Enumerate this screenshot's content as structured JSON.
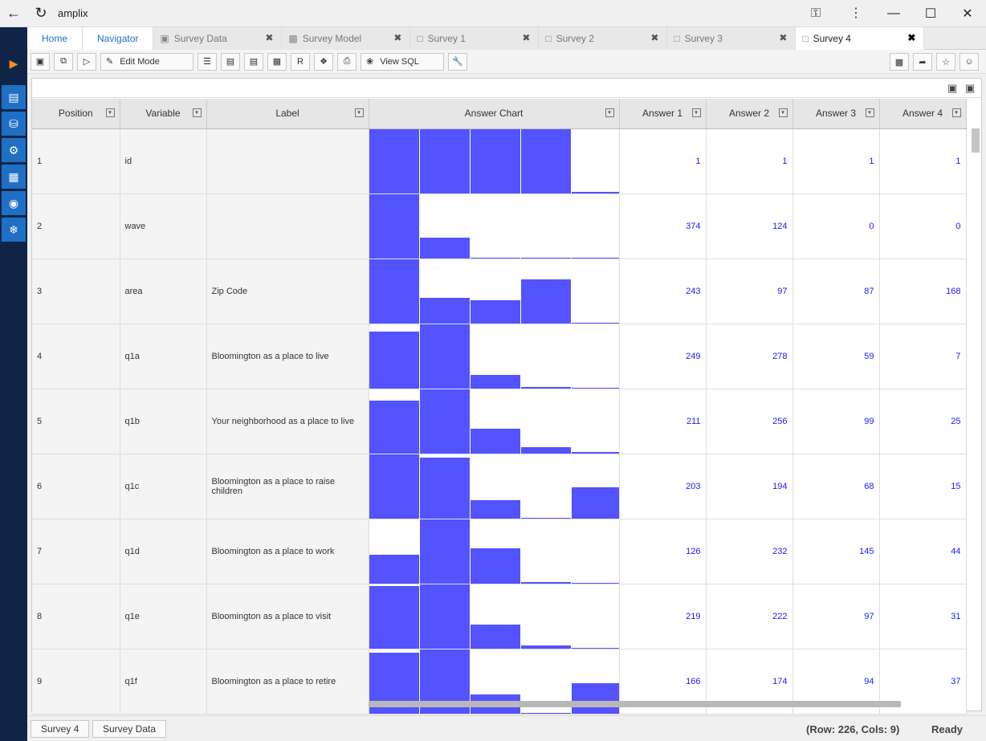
{
  "window": {
    "title": "amplix",
    "minimize": "—",
    "maximize": "☐",
    "close": "✕"
  },
  "nav": {
    "home": "Home",
    "navigator": "Navigator"
  },
  "tabs": [
    {
      "label": "Survey Data",
      "icon": "cube-icon"
    },
    {
      "label": "Survey Model",
      "icon": "model-icon"
    },
    {
      "label": "Survey 1",
      "icon": "file-icon"
    },
    {
      "label": "Survey 2",
      "icon": "file-icon"
    },
    {
      "label": "Survey 3",
      "icon": "file-icon"
    },
    {
      "label": "Survey 4",
      "icon": "file-icon",
      "active": true
    }
  ],
  "toolbar": {
    "edit_mode": "Edit Mode",
    "view_sql": "View SQL"
  },
  "columns": [
    "Position",
    "Variable",
    "Label",
    "Answer Chart",
    "Answer 1",
    "Answer 2",
    "Answer 3",
    "Answer 4"
  ],
  "rows": [
    {
      "position": "1",
      "variable": "id",
      "label": "",
      "answers": [
        "1",
        "1",
        "1",
        "1"
      ]
    },
    {
      "position": "2",
      "variable": "wave",
      "label": "",
      "answers": [
        "374",
        "124",
        "0",
        "0"
      ]
    },
    {
      "position": "3",
      "variable": "area",
      "label": "Zip Code",
      "answers": [
        "243",
        "97",
        "87",
        "168"
      ]
    },
    {
      "position": "4",
      "variable": "q1a",
      "label": "Bloomington as a place to live",
      "answers": [
        "249",
        "278",
        "59",
        "7"
      ]
    },
    {
      "position": "5",
      "variable": "q1b",
      "label": "Your neighborhood as a place to live",
      "answers": [
        "211",
        "256",
        "99",
        "25"
      ]
    },
    {
      "position": "6",
      "variable": "q1c",
      "label": "Bloomington as a place to raise children",
      "answers": [
        "203",
        "194",
        "68",
        "15"
      ]
    },
    {
      "position": "7",
      "variable": "q1d",
      "label": "Bloomington as a place to work",
      "answers": [
        "126",
        "232",
        "145",
        "44"
      ]
    },
    {
      "position": "8",
      "variable": "q1e",
      "label": "Bloomington as a place to visit",
      "answers": [
        "219",
        "222",
        "97",
        "31"
      ]
    },
    {
      "position": "9",
      "variable": "q1f",
      "label": "Bloomington as a place to retire",
      "answers": [
        "166",
        "174",
        "94",
        "37"
      ]
    }
  ],
  "chart_data": {
    "type": "bar",
    "note_series": "Answer Chart sparkline bars per row, fraction of cell height",
    "rows": [
      [
        1.0,
        1.0,
        1.0,
        1.0,
        0.02
      ],
      [
        1.0,
        0.33,
        0.01,
        0.01,
        0.01
      ],
      [
        1.0,
        0.4,
        0.36,
        0.69,
        0.01
      ],
      [
        0.89,
        1.0,
        0.21,
        0.02,
        0.01
      ],
      [
        0.82,
        1.0,
        0.39,
        0.1,
        0.02
      ],
      [
        1.0,
        0.95,
        0.29,
        0.01,
        0.49
      ],
      [
        0.45,
        1.0,
        0.55,
        0.03,
        0.01
      ],
      [
        0.98,
        1.0,
        0.38,
        0.05,
        0.01
      ],
      [
        0.95,
        1.0,
        0.3,
        0.0,
        0.48
      ]
    ]
  },
  "status": {
    "tab1": "Survey 4",
    "tab2": "Survey Data",
    "info": "(Row: 226, Cols: 9)",
    "state": "Ready"
  },
  "colors": {
    "bar": "#5353ff",
    "number": "#1a1aff",
    "sidebar": "#0f2447",
    "accent": "#1f6fc5"
  }
}
